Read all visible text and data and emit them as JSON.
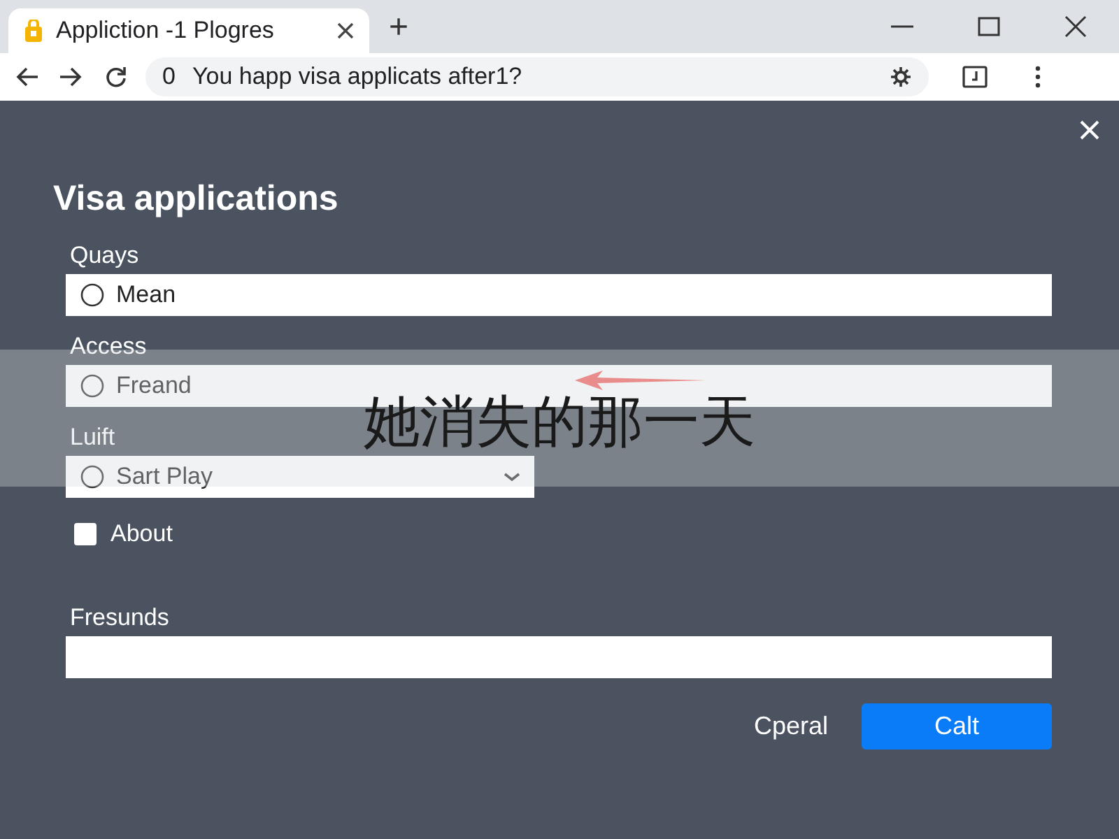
{
  "browser": {
    "tab_title": "Appliction -1 Plogres",
    "new_tab": "+",
    "address_prefix": "0",
    "address": "You happ visa applicats after1?"
  },
  "dialog": {
    "title": "Visa applications",
    "fields": [
      {
        "kind": "radio",
        "label": "Quays",
        "option": "Mean",
        "checked": false
      },
      {
        "kind": "radio",
        "label": "Access",
        "option": "Freand",
        "checked": false
      },
      {
        "kind": "select",
        "label": "Luift",
        "value": "Sart Play",
        "checked": false
      },
      {
        "kind": "checkbox",
        "label": "About",
        "checked": false
      },
      {
        "kind": "text",
        "label": "Fresunds"
      }
    ],
    "buttons": [
      {
        "kind": "text",
        "label": "Cperal"
      },
      {
        "kind": "primary",
        "label": "Calt"
      }
    ]
  },
  "overlay": {
    "caption": "她消失的那一天"
  }
}
